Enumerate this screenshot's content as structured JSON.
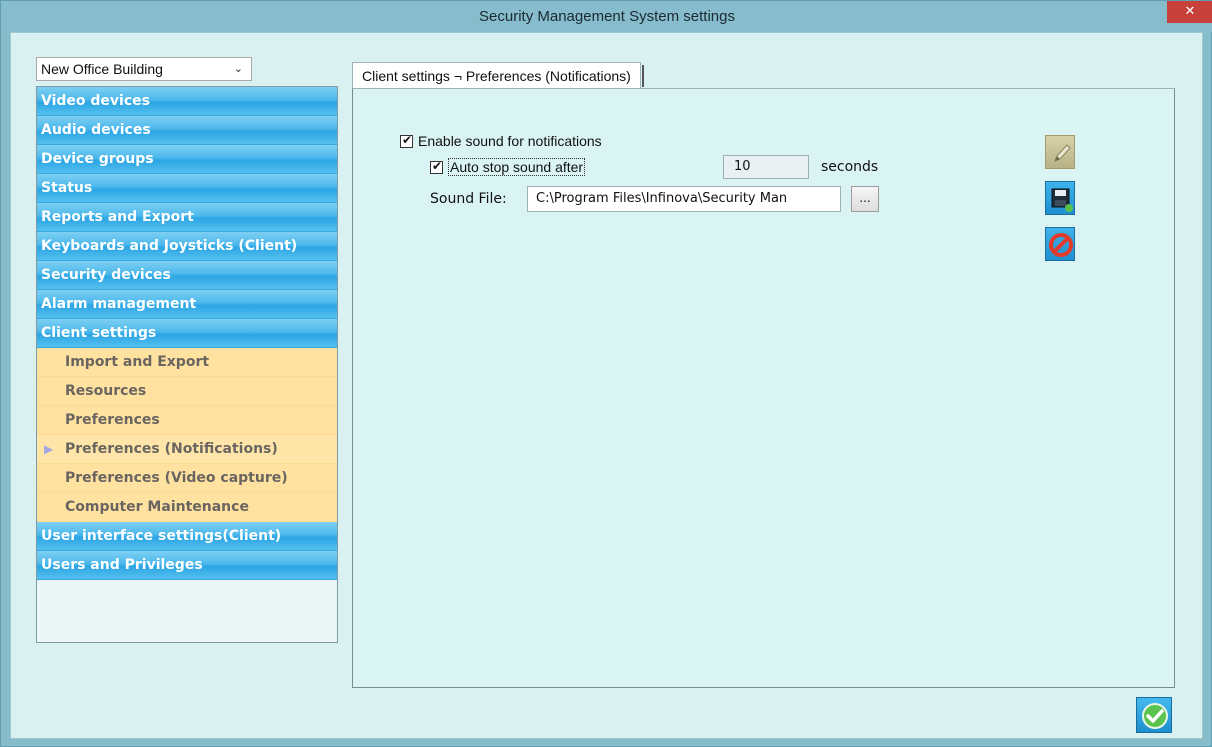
{
  "window": {
    "title": "Security Management System settings",
    "close_label": "✕"
  },
  "building_select": {
    "value": "New Office Building",
    "chevron": "⌄"
  },
  "sidebar": {
    "items": [
      {
        "label": "Video devices"
      },
      {
        "label": "Audio devices"
      },
      {
        "label": "Device groups"
      },
      {
        "label": "Status"
      },
      {
        "label": "Reports and Export"
      },
      {
        "label": "Keyboards and Joysticks (Client)"
      },
      {
        "label": "Security devices"
      },
      {
        "label": "Alarm management"
      },
      {
        "label": "Client settings"
      }
    ],
    "sub_items": [
      {
        "label": "Import and Export"
      },
      {
        "label": "Resources"
      },
      {
        "label": "Preferences"
      },
      {
        "label": "Preferences (Notifications)",
        "active": true
      },
      {
        "label": "Preferences (Video capture)"
      },
      {
        "label": "Computer Maintenance"
      }
    ],
    "after_items": [
      {
        "label": "User interface settings(Client)"
      },
      {
        "label": "Users and Privileges"
      }
    ],
    "active_marker": "▶"
  },
  "tab": {
    "label": "Client settings ¬ Preferences (Notifications)"
  },
  "form": {
    "enable_sound_label": "Enable sound for notifications",
    "enable_sound_checked": true,
    "auto_stop_label": "Auto stop sound after",
    "auto_stop_checked": true,
    "auto_stop_value": "10",
    "seconds_label": "seconds",
    "sound_file_label": "Sound File:",
    "sound_file_value": "C:\\Program Files\\Infinova\\Security Man",
    "browse_label": "..."
  },
  "toolbar": {
    "edit_icon": "pencil-icon",
    "save_icon": "save-icon",
    "cancel_icon": "cancel-icon"
  },
  "footer": {
    "ok_icon": "checkmark-icon"
  },
  "colors": {
    "window_chrome": "#86bccc",
    "nav_blue": "#2ca6e4",
    "sub_yellow": "#ffe2a0",
    "panel_bg": "#daf3f3",
    "close_red": "#c7403a"
  }
}
